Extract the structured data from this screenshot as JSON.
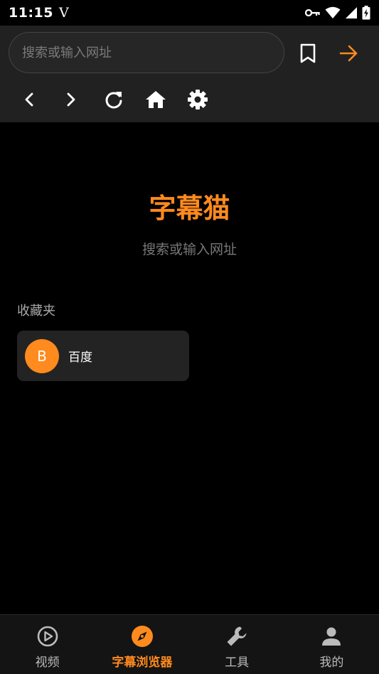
{
  "status_bar": {
    "time": "11:15",
    "app_glyph": "V",
    "icons": [
      "key-icon",
      "wifi-icon",
      "signal-icon",
      "battery-charging-icon"
    ]
  },
  "toolbar": {
    "search": {
      "value": "",
      "placeholder": "搜索或输入网址"
    },
    "bookmark_icon": "bookmark-icon",
    "go_icon": "arrow-right-icon",
    "nav_icons": [
      "chevron-left-icon",
      "chevron-right-icon",
      "refresh-icon",
      "home-icon",
      "settings-icon"
    ]
  },
  "main": {
    "title": "字幕猫",
    "subtitle": "搜索或输入网址",
    "favorites": {
      "section_title": "收藏夹",
      "items": [
        {
          "initial": "B",
          "label": "百度"
        }
      ]
    }
  },
  "bottom_nav": {
    "items": [
      {
        "label": "视频",
        "icon": "play-circle-icon",
        "active": false
      },
      {
        "label": "字幕浏览器",
        "icon": "compass-icon",
        "active": true
      },
      {
        "label": "工具",
        "icon": "wrench-icon",
        "active": false
      },
      {
        "label": "我的",
        "icon": "person-icon",
        "active": false
      }
    ]
  },
  "colors": {
    "accent": "#ff8a1e",
    "toolbar_bg": "#212121",
    "background": "#000000",
    "inactive": "#bbbbbb"
  }
}
